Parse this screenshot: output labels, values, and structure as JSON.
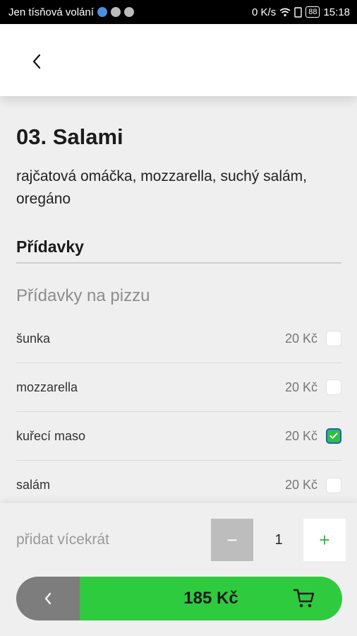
{
  "status_bar": {
    "carrier": "Jen tísňová volání",
    "net_speed": "0 K/s",
    "battery": "88",
    "time": "15:18"
  },
  "product": {
    "title": "03. Salami",
    "description": "rajčatová omáčka, mozzarella, suchý salám, oregáno"
  },
  "section": {
    "title": "Přídavky",
    "group_label": "Přídavky na pizzu",
    "options": [
      {
        "name": "šunka",
        "price": "20 Kč",
        "checked": false
      },
      {
        "name": "mozzarella",
        "price": "20 Kč",
        "checked": false
      },
      {
        "name": "kuřecí maso",
        "price": "20 Kč",
        "checked": true
      },
      {
        "name": "salám",
        "price": "20 Kč",
        "checked": false
      }
    ]
  },
  "quantity": {
    "label": "přidat vícekrát",
    "minus": "−",
    "value": "1",
    "plus": "+"
  },
  "cart": {
    "price": "185 Kč"
  },
  "colors": {
    "accent_green": "#2ecb3f",
    "check_green": "#2dc043",
    "check_border": "#1d5fd0",
    "back_gray": "#7d7d7d"
  },
  "icons": {
    "back": "chevron-left-icon",
    "cart": "cart-icon",
    "check": "check-icon"
  }
}
